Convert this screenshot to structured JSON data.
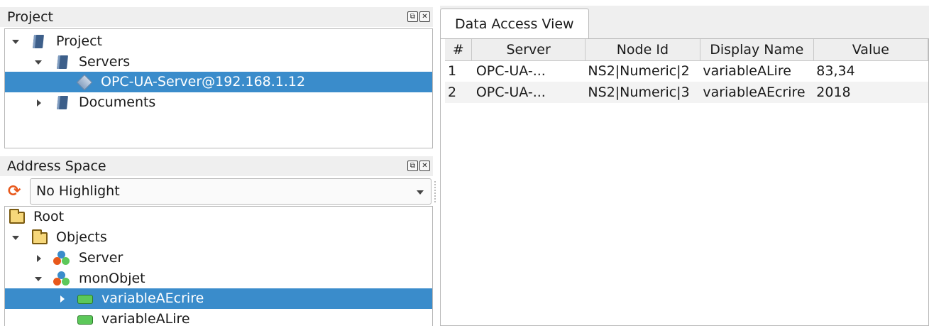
{
  "project_dock": {
    "title": "Project",
    "tree": [
      {
        "label": "Project",
        "icon": "book-icon"
      },
      {
        "label": "Servers",
        "icon": "book-icon"
      },
      {
        "label": "OPC-UA-Server@192.168.1.12",
        "icon": "server-icon",
        "selected": true
      },
      {
        "label": "Documents",
        "icon": "book-icon"
      }
    ]
  },
  "address_dock": {
    "title": "Address Space",
    "highlight_value": "No Highlight",
    "tree": [
      {
        "label": "Root",
        "icon": "folder-icon"
      },
      {
        "label": "Objects",
        "icon": "folder-icon"
      },
      {
        "label": "Server",
        "icon": "object-icon"
      },
      {
        "label": "monObjet",
        "icon": "object-icon"
      },
      {
        "label": "variableAEcrire",
        "icon": "variable-icon",
        "selected": true
      },
      {
        "label": "variableALire",
        "icon": "variable-icon"
      }
    ]
  },
  "data_access": {
    "tab_label": "Data Access View",
    "columns": [
      "#",
      "Server",
      "Node Id",
      "Display Name",
      "Value"
    ],
    "rows": [
      [
        "1",
        "OPC-UA-...",
        "NS2|Numeric|2",
        "variableALire",
        "83,34"
      ],
      [
        "2",
        "OPC-UA-...",
        "NS2|Numeric|3",
        "variableAEcrire",
        "2018"
      ]
    ]
  },
  "colors": {
    "selection": "#3a8ccb",
    "accent": "#e8581b"
  }
}
